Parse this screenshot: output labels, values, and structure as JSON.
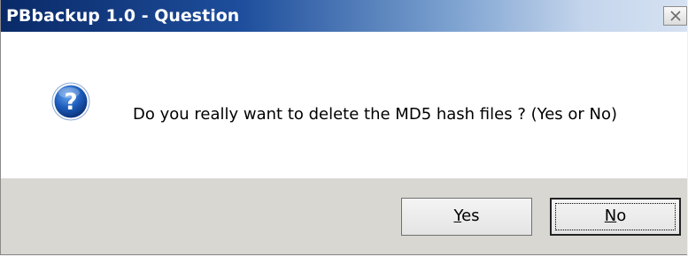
{
  "window": {
    "title": "PBbackup 1.0 - Question",
    "close_icon": "close-icon"
  },
  "dialog": {
    "icon": "question-icon",
    "message": "Do you really want to delete the MD5 hash files ? (Yes or No)"
  },
  "buttons": {
    "yes": {
      "mnemonic": "Y",
      "rest": "es"
    },
    "no": {
      "mnemonic": "N",
      "rest": "o"
    }
  },
  "colors": {
    "titlebar_start": "#0a2a68",
    "titlebar_end": "#d6e2f2",
    "icon_blue": "#1f5fbf",
    "footer_bg": "#d9d7d2"
  }
}
